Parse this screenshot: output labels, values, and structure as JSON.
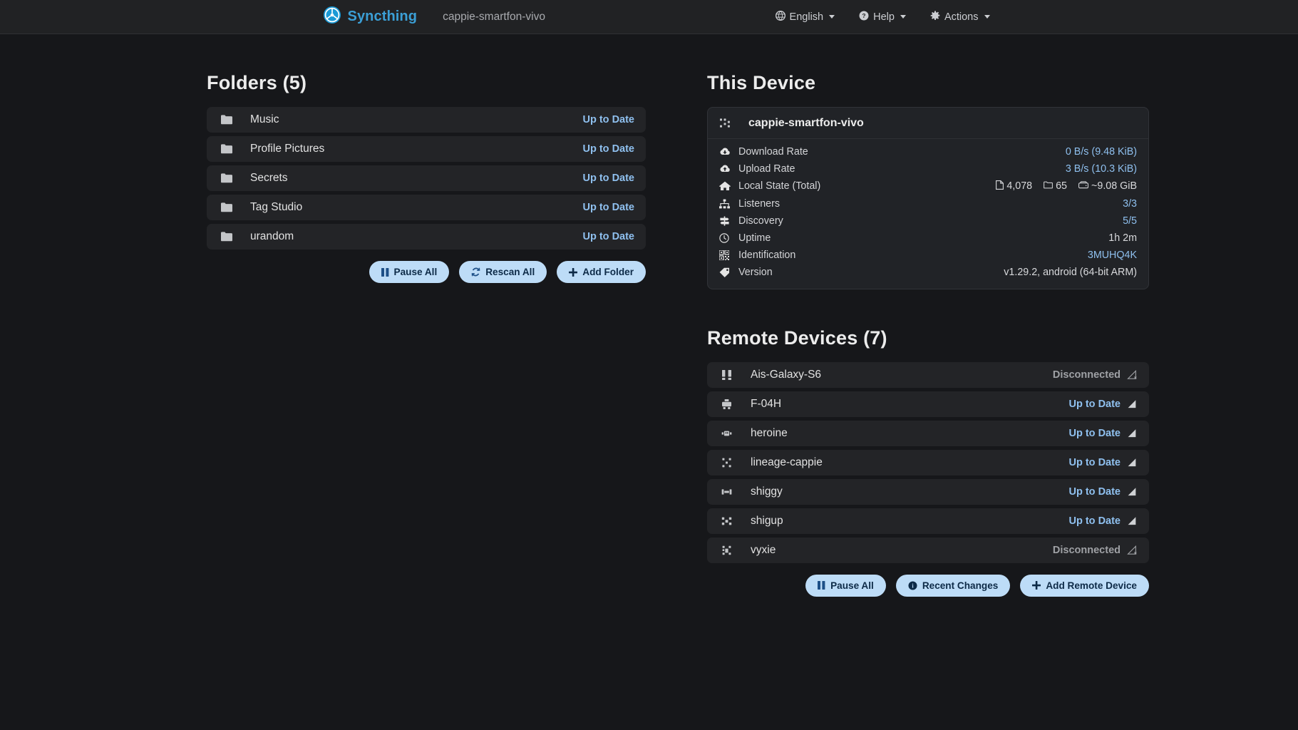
{
  "navbar": {
    "brand": "Syncthing",
    "brand_icon": "syncthing-logo-icon",
    "device_name": "cappie-smartfon-vivo",
    "items": [
      {
        "label": "English",
        "icon": "globe-icon"
      },
      {
        "label": "Help",
        "icon": "question-circle-icon"
      },
      {
        "label": "Actions",
        "icon": "gear-icon"
      }
    ]
  },
  "folders": {
    "title": "Folders (5)",
    "items": [
      {
        "name": "Music",
        "status": "Up to Date",
        "icon": "folder-icon"
      },
      {
        "name": "Profile Pictures",
        "status": "Up to Date",
        "icon": "folder-icon"
      },
      {
        "name": "Secrets",
        "status": "Up to Date",
        "icon": "folder-icon"
      },
      {
        "name": "Tag Studio",
        "status": "Up to Date",
        "icon": "folder-icon"
      },
      {
        "name": "urandom",
        "status": "Up to Date",
        "icon": "folder-icon"
      }
    ],
    "buttons": [
      {
        "label": "Pause All",
        "icon": "pause-icon"
      },
      {
        "label": "Rescan All",
        "icon": "refresh-icon"
      },
      {
        "label": "Add Folder",
        "icon": "plus-icon"
      }
    ]
  },
  "this_device": {
    "title": "This Device",
    "name": "cappie-smartfon-vivo",
    "name_icon": "mobile-device-icon",
    "stats": [
      {
        "key": "Download Rate",
        "value": "0 B/s (9.48 KiB)",
        "icon": "cloud-download-icon",
        "accent": true
      },
      {
        "key": "Upload Rate",
        "value": "3 B/s (10.3 KiB)",
        "icon": "cloud-upload-icon",
        "accent": true
      },
      {
        "key": "Local State (Total)",
        "icon": "home-icon",
        "local_state": true,
        "files": "4,078",
        "folders": "65",
        "size": "~9.08 GiB"
      },
      {
        "key": "Listeners",
        "value": "3/3",
        "icon": "sitemap-icon",
        "accent": true
      },
      {
        "key": "Discovery",
        "value": "5/5",
        "icon": "signpost-icon",
        "accent": true
      },
      {
        "key": "Uptime",
        "value": "1h 2m",
        "icon": "clock-icon",
        "accent": false
      },
      {
        "key": "Identification",
        "value": "3MUHQ4K",
        "icon": "qrcode-icon",
        "accent": true
      },
      {
        "key": "Version",
        "value": "v1.29.2, android (64-bit ARM)",
        "icon": "tag-icon",
        "accent": false
      }
    ]
  },
  "remote_devices": {
    "title": "Remote Devices (7)",
    "items": [
      {
        "name": "Ais-Galaxy-S6",
        "status": "Disconnected",
        "connected": false,
        "icon": "phone-device-icon"
      },
      {
        "name": "F-04H",
        "status": "Up to Date",
        "connected": true,
        "icon": "phone-device-icon"
      },
      {
        "name": "heroine",
        "status": "Up to Date",
        "connected": true,
        "icon": "phone-device-icon"
      },
      {
        "name": "lineage-cappie",
        "status": "Up to Date",
        "connected": true,
        "icon": "phone-device-icon"
      },
      {
        "name": "shiggy",
        "status": "Up to Date",
        "connected": true,
        "icon": "phone-device-icon"
      },
      {
        "name": "shigup",
        "status": "Up to Date",
        "connected": true,
        "icon": "phone-device-icon"
      },
      {
        "name": "vyxie",
        "status": "Disconnected",
        "connected": false,
        "icon": "phone-device-icon"
      }
    ],
    "buttons": [
      {
        "label": "Pause All",
        "icon": "pause-icon"
      },
      {
        "label": "Recent Changes",
        "icon": "info-circle-icon"
      },
      {
        "label": "Add Remote Device",
        "icon": "plus-icon"
      }
    ]
  },
  "colors": {
    "background": "#16171a",
    "surface": "#232427",
    "accent_blue": "#8fc0ef",
    "brand_blue": "#3b9fd6",
    "button_bg": "#bddcf7",
    "button_fg": "#0d2a47",
    "muted_text": "#9fa1a5"
  }
}
